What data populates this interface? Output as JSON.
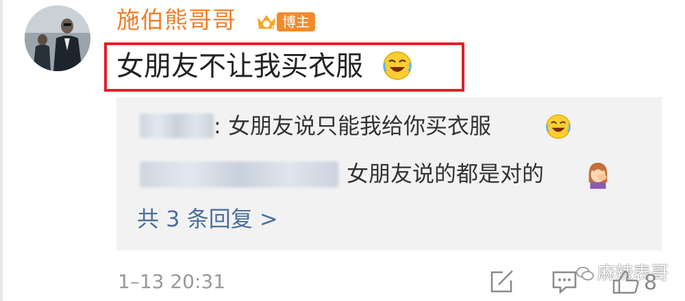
{
  "post": {
    "username": "施伯熊哥哥",
    "badge": "博主",
    "comment": "女朋友不让我买衣服",
    "timestamp": "1–13 20:31",
    "like_count": "8"
  },
  "replies": [
    {
      "text": ": 女朋友说只能我给你买衣服",
      "emoji": "laughing-crying-emoji"
    },
    {
      "text": "女朋友说的都是对的",
      "emoji": "facepalm-woman-emoji"
    }
  ],
  "more_replies": "共 3 条回复 >",
  "watermark": "麻辣表哥",
  "colors": {
    "username": "#ee7f2d",
    "highlight_box": "#e02027",
    "link": "#4a6d9c",
    "reply_bg": "#f2f2f2"
  }
}
